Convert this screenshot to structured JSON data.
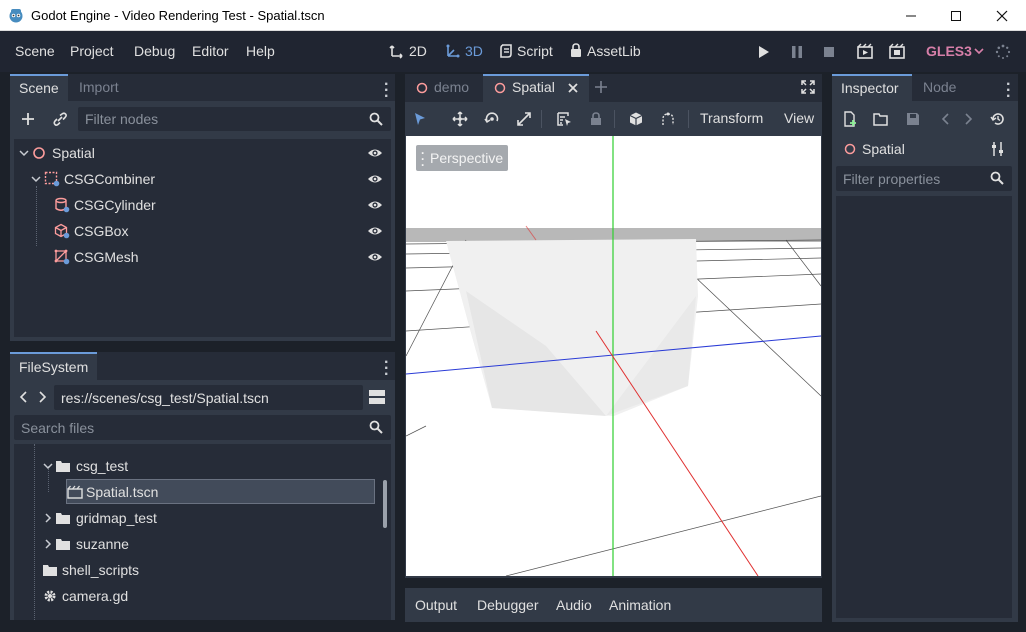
{
  "window": {
    "title": "Godot Engine - Video Rendering Test - Spatial.tscn",
    "minimize_icon": "minimize-icon",
    "maximize_icon": "maximize-icon",
    "close_icon": "close-icon"
  },
  "menu": {
    "items": [
      "Scene",
      "Project",
      "Debug",
      "Editor",
      "Help"
    ]
  },
  "modes": {
    "2d": "2D",
    "3d": "3D",
    "script": "Script",
    "assetlib": "AssetLib"
  },
  "renderer": "GLES3",
  "scene_dock": {
    "tabs": [
      "Scene",
      "Import"
    ],
    "filter_placeholder": "Filter nodes",
    "tree": [
      {
        "label": "Spatial",
        "icon": "spatial-node-icon",
        "depth": 0
      },
      {
        "label": "CSGCombiner",
        "icon": "csg-combiner-icon",
        "depth": 1
      },
      {
        "label": "CSGCylinder",
        "icon": "csg-cylinder-icon",
        "depth": 2
      },
      {
        "label": "CSGBox",
        "icon": "csg-box-icon",
        "depth": 2
      },
      {
        "label": "CSGMesh",
        "icon": "csg-mesh-icon",
        "depth": 2
      }
    ]
  },
  "filesystem_dock": {
    "tab": "FileSystem",
    "path": "res://scenes/csg_test/Spatial.tscn",
    "search_placeholder": "Search files",
    "items": [
      {
        "label": "csg_test",
        "type": "folder",
        "expanded": true
      },
      {
        "label": "Spatial.tscn",
        "type": "scene",
        "selected": true
      },
      {
        "label": "gridmap_test",
        "type": "folder",
        "expanded": false
      },
      {
        "label": "suzanne",
        "type": "folder",
        "expanded": false
      },
      {
        "label": "shell_scripts",
        "type": "folder"
      },
      {
        "label": "camera.gd",
        "type": "script"
      }
    ]
  },
  "editor_tabs": [
    "demo",
    "Spatial"
  ],
  "viewport": {
    "toolbar_menus": [
      "Transform",
      "View"
    ],
    "perspective_label": "Perspective"
  },
  "bottom_panel": {
    "tabs": [
      "Output",
      "Debugger",
      "Audio",
      "Animation"
    ]
  },
  "inspector": {
    "tabs": [
      "Inspector",
      "Node"
    ],
    "object_name": "Spatial",
    "filter_placeholder": "Filter properties"
  },
  "colors": {
    "accent": "#6b9bd9",
    "renderer": "#d77fa9",
    "background": "#1c2129",
    "panel": "#323a47",
    "field": "#262c38"
  }
}
